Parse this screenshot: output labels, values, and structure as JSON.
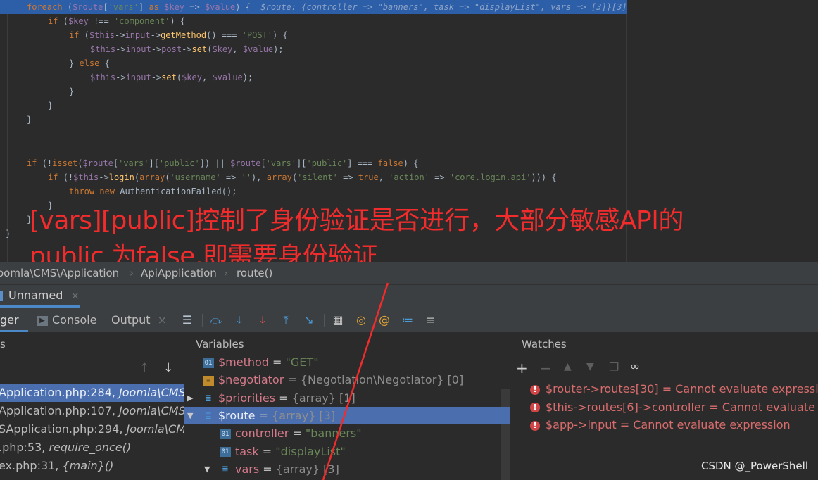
{
  "editor": {
    "line1_foreach": "foreach",
    "line1_route": "$route",
    "line1_vars_key": "'vars'",
    "line1_as": "as",
    "line1_key": "$key",
    "line1_value": "$value",
    "line1_inline": "$route: {controller => \"banners\", task => \"displayList\", vars => [3]}[3]",
    "annotation_line1": "[vars][public]控制了身份验证是否进行，大部分敏感API的",
    "annotation_line2": "public 为false,即需要身份验证"
  },
  "breadcrumb": {
    "namespace": "oomla\\CMS\\Application",
    "class": "ApiApplication",
    "method": "route()"
  },
  "session": {
    "tab_label": "Unnamed"
  },
  "toolbar": {
    "debugger_tab": "ger",
    "console_tab": "Console",
    "output_tab": "Output"
  },
  "frames": {
    "header": "s",
    "items": [
      {
        "file": "Application.php:284, ",
        "ns": "Joomla\\CMS\\Ap"
      },
      {
        "file": "Application.php:107, ",
        "ns": "Joomla\\CMS\\Ap"
      },
      {
        "file": "SApplication.php:294, ",
        "ns": "Joomla\\CMS\\A"
      },
      {
        "file": ".php:53, ",
        "ns": "require_once()"
      },
      {
        "file": "ex.php:31, ",
        "ns": "{main}()"
      }
    ]
  },
  "variables": {
    "header": "Variables",
    "rows": [
      {
        "name": "$method",
        "eq": " = ",
        "value": "\"GET\"",
        "type": ""
      },
      {
        "name": "$negotiator",
        "eq": " = ",
        "value": "",
        "type": "{Negotiation\\Negotiator} [0]"
      },
      {
        "name": "$priorities",
        "eq": " = ",
        "value": "",
        "type": "{array} [1]"
      },
      {
        "name": "$route",
        "eq": " = ",
        "value": "",
        "type": "{array} [3]"
      },
      {
        "name": "controller",
        "eq": " = ",
        "value": "\"banners\"",
        "type": ""
      },
      {
        "name": "task",
        "eq": " = ",
        "value": "\"displayList\"",
        "type": ""
      },
      {
        "name": "vars",
        "eq": " = ",
        "value": "",
        "type": "{array} [3]"
      }
    ]
  },
  "watches": {
    "header": "Watches",
    "items": [
      {
        "expr": "$router->routes[30]",
        "result": " = Cannot evaluate expression"
      },
      {
        "expr": "$this->routes[6]->controller",
        "result": " = Cannot evaluate expre"
      },
      {
        "expr": "$app->input",
        "result": " = Cannot evaluate expression"
      }
    ]
  },
  "watermark": "CSDN @_PowerShell",
  "colors": {
    "accent": "#4b6eaf",
    "annotation": "#f22c2c",
    "error": "#d86c6c"
  }
}
